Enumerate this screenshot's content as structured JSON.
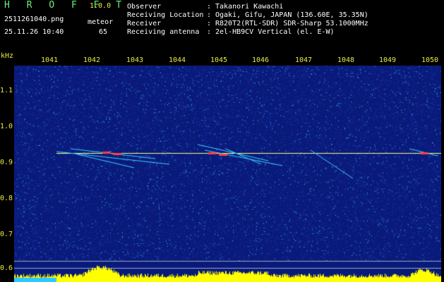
{
  "header": {
    "app_title": "H R O F F T",
    "app_version": "1.0.0",
    "filename": "2511261040.png",
    "datetime": "25.11.26 10:40",
    "meteor_label": "meteor",
    "meteor_count": "65"
  },
  "info": [
    {
      "key": "Observer",
      "sep": ":",
      "value": "Takanori Kawachi"
    },
    {
      "key": "Receiving Location",
      "sep": ":",
      "value": "Ogaki, Gifu, JAPAN (136.60E, 35.35N)"
    },
    {
      "key": "Receiver",
      "sep": ":",
      "value": "R820T2(RTL-SDR) SDR-Sharp 53.1000MHz"
    },
    {
      "key": "Receiving antenna",
      "sep": ":",
      "value": "2el-HB9CV Vertical (el. E-W)"
    }
  ],
  "axes": {
    "y_unit": "kHz",
    "x_ticks": [
      "1041",
      "1042",
      "1043",
      "1044",
      "1045",
      "1046",
      "1047",
      "1048",
      "1049",
      "1050"
    ],
    "y_ticks": [
      "1.1",
      "1.0",
      "0.9",
      "0.8",
      "0.7",
      "0.6"
    ]
  },
  "colors": {
    "background": "#0a1a7a",
    "noise": "#3ad0ff",
    "carrier": "#ffff80",
    "meteor": "#ff4040",
    "baseline": "#ffff00",
    "label": "#e8e84a"
  }
}
